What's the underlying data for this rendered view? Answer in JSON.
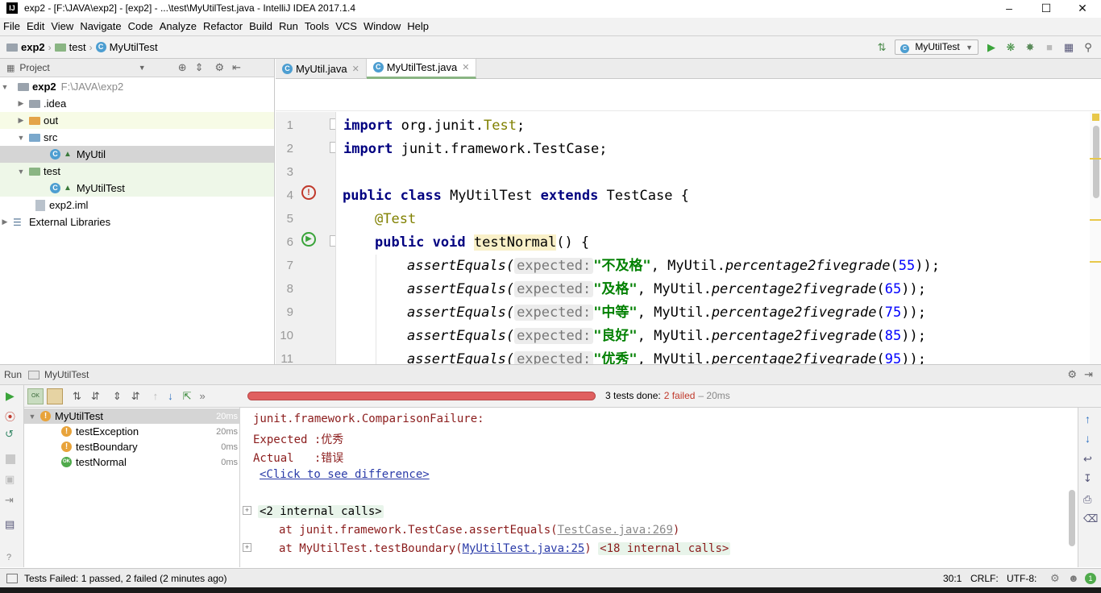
{
  "window": {
    "title": "exp2 - [F:\\JAVA\\exp2] - [exp2] - ...\\test\\MyUtilTest.java - IntelliJ IDEA 2017.1.4",
    "app_icon_text": "IJ"
  },
  "menu": [
    "File",
    "Edit",
    "View",
    "Navigate",
    "Code",
    "Analyze",
    "Refactor",
    "Build",
    "Run",
    "Tools",
    "VCS",
    "Window",
    "Help"
  ],
  "breadcrumb": {
    "project": "exp2",
    "folder": "test",
    "file": "MyUtilTest"
  },
  "run_config": {
    "selected": "MyUtilTest"
  },
  "project_panel": {
    "title": "Project",
    "tree": [
      {
        "label": "exp2",
        "path": "F:\\JAVA\\exp2",
        "icon": "folder-icon"
      },
      {
        "label": ".idea",
        "icon": "folder-icon"
      },
      {
        "label": "out",
        "icon": "folder-icon"
      },
      {
        "label": "src",
        "icon": "folder-icon"
      },
      {
        "label": "MyUtil",
        "icon": "class-icon"
      },
      {
        "label": "test",
        "icon": "folder-icon"
      },
      {
        "label": "MyUtilTest",
        "icon": "class-icon"
      },
      {
        "label": "exp2.iml",
        "icon": "file-icon"
      },
      {
        "label": "External Libraries",
        "icon": "library-icon"
      }
    ]
  },
  "editor": {
    "tabs": [
      {
        "label": "MyUtil.java",
        "active": false
      },
      {
        "label": "MyUtilTest.java",
        "active": true
      }
    ],
    "line_numbers": [
      "1",
      "2",
      "3",
      "4",
      "5",
      "6",
      "7",
      "8",
      "9",
      "10",
      "11"
    ],
    "code": {
      "l1_kw": "import",
      "l1_pkg": " org.junit.",
      "l1_cls": "Test",
      "l1_end": ";",
      "l2_kw": "import",
      "l2_rest": " junit.framework.TestCase;",
      "l4_kw1": "public class",
      "l4_name": " MyUtilTest ",
      "l4_kw2": "extends",
      "l4_rest": " TestCase {",
      "l5_ann": "@Test",
      "l6_kw": "public void",
      "l6_name": "testNormal",
      "l6_rest": "() {",
      "assert_fn": "assertEquals(",
      "hint": "expected:",
      "call": "MyUtil.",
      "call_fn": "percentage2fivegrade",
      "rows": [
        {
          "str": "\"不及格\"",
          "num": "55"
        },
        {
          "str": "\"及格\"",
          "num": "65"
        },
        {
          "str": "\"中等\"",
          "num": "75"
        },
        {
          "str": "\"良好\"",
          "num": "85"
        },
        {
          "str": "\"优秀\"",
          "num": "95"
        }
      ]
    }
  },
  "run_window": {
    "label": "Run",
    "config": "MyUtilTest",
    "summary": "3 tests done:",
    "failed": "2 failed",
    "duration": "– 20ms",
    "tests": [
      {
        "name": "MyUtilTest",
        "time": "20ms",
        "status": "failed"
      },
      {
        "name": "testException",
        "time": "20ms",
        "status": "failed"
      },
      {
        "name": "testBoundary",
        "time": "0ms",
        "status": "failed"
      },
      {
        "name": "testNormal",
        "time": "0ms",
        "status": "passed"
      }
    ],
    "console": {
      "l1": "junit.framework.ComparisonFailure:",
      "l2": "Expected :优秀",
      "l3": "Actual   :错误",
      "l4": "<Click to see difference>",
      "l5": "<2 internal calls>",
      "l6_pre": "at junit.framework.TestCase.assertEquals(",
      "l6_link": "TestCase.java:269",
      "l6_post": ")",
      "l7_pre": "at MyUtilTest.testBoundary(",
      "l7_link": "MyUtilTest.java:25",
      "l7_post": ")",
      "l7_calls": "<18 internal calls>"
    }
  },
  "status": {
    "message": "Tests Failed: 1 passed, 2 failed (2 minutes ago)",
    "position": "30:1",
    "line_sep": "CRLF:",
    "encoding": "UTF-8:"
  },
  "colors": {
    "fail": "#e06060",
    "pass": "#4faa4b",
    "warn": "#e8a33a"
  }
}
